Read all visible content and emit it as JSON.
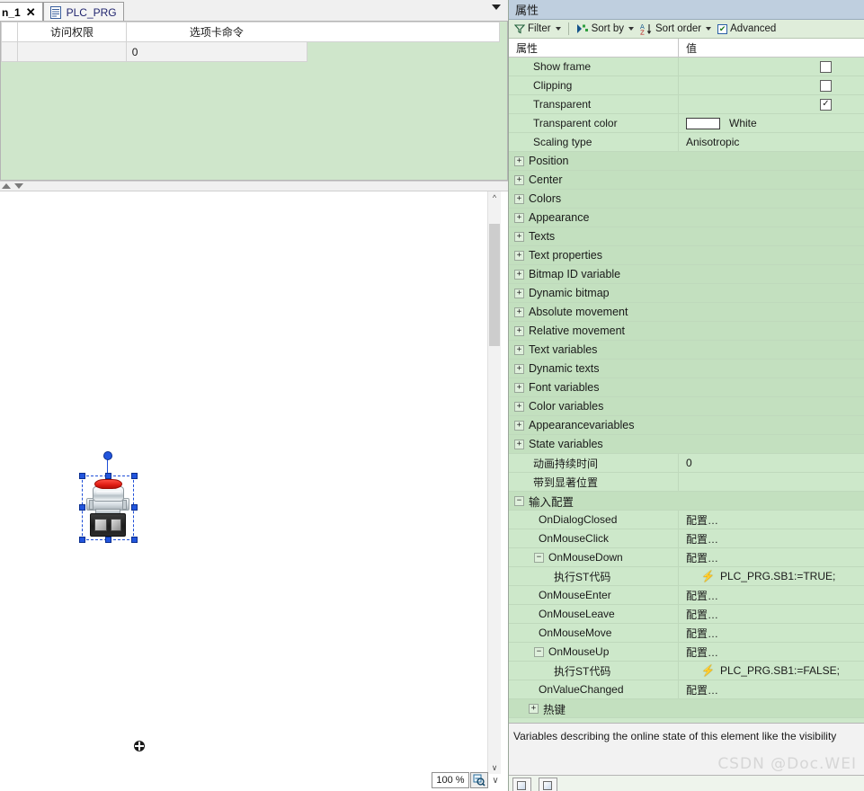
{
  "tabs": [
    {
      "label": "n_1",
      "closable": true,
      "active": true,
      "icon": ""
    },
    {
      "label": "PLC_PRG",
      "closable": false,
      "active": false,
      "icon": "document-icon"
    }
  ],
  "editor_grid": {
    "columns": [
      "",
      "访问权限",
      "选项卡命令",
      ""
    ],
    "rows": [
      [
        "",
        "",
        "0",
        ""
      ]
    ]
  },
  "canvas": {
    "element_name": "push-button-bitmap",
    "zoom_value": "100",
    "zoom_unit": "%"
  },
  "properties": {
    "title": "属性",
    "toolbar": {
      "filter_label": "Filter",
      "sort_by_label": "Sort by",
      "sort_order_label": "Sort order",
      "advanced_label": "Advanced",
      "advanced_checked": "✔"
    },
    "header": {
      "name": "属性",
      "value": "值"
    },
    "rows": [
      {
        "indent": 1,
        "name": "Show frame",
        "type": "checkbox",
        "checked": false
      },
      {
        "indent": 1,
        "name": "Clipping",
        "type": "checkbox",
        "checked": false
      },
      {
        "indent": 1,
        "name": "Transparent",
        "type": "checkbox",
        "checked": true
      },
      {
        "indent": 1,
        "name": "Transparent color",
        "type": "color",
        "value": "White",
        "swatch": "#ffffff"
      },
      {
        "indent": 1,
        "name": "Scaling type",
        "type": "text",
        "value": "Anisotropic"
      },
      {
        "indent": 0,
        "name": "Position",
        "type": "section",
        "expander": "+"
      },
      {
        "indent": 0,
        "name": "Center",
        "type": "section",
        "expander": "+"
      },
      {
        "indent": 0,
        "name": "Colors",
        "type": "section",
        "expander": "+"
      },
      {
        "indent": 0,
        "name": "Appearance",
        "type": "section",
        "expander": "+"
      },
      {
        "indent": 0,
        "name": "Texts",
        "type": "section",
        "expander": "+"
      },
      {
        "indent": 0,
        "name": "Text properties",
        "type": "section",
        "expander": "+"
      },
      {
        "indent": 0,
        "name": "Bitmap ID variable",
        "type": "section",
        "expander": "+"
      },
      {
        "indent": 0,
        "name": "Dynamic bitmap",
        "type": "section",
        "expander": "+"
      },
      {
        "indent": 0,
        "name": "Absolute movement",
        "type": "section",
        "expander": "+"
      },
      {
        "indent": 0,
        "name": "Relative movement",
        "type": "section",
        "expander": "+"
      },
      {
        "indent": 0,
        "name": "Text variables",
        "type": "section",
        "expander": "+"
      },
      {
        "indent": 0,
        "name": "Dynamic texts",
        "type": "section",
        "expander": "+"
      },
      {
        "indent": 0,
        "name": "Font variables",
        "type": "section",
        "expander": "+"
      },
      {
        "indent": 0,
        "name": "Color variables",
        "type": "section",
        "expander": "+"
      },
      {
        "indent": 0,
        "name": "Appearancevariables",
        "type": "section",
        "expander": "+"
      },
      {
        "indent": 0,
        "name": "State variables",
        "type": "section",
        "expander": "+"
      },
      {
        "indent": 1,
        "name": "动画持续时间",
        "type": "text",
        "value": "0"
      },
      {
        "indent": 1,
        "name": "带到显著位置",
        "type": "text",
        "value": ""
      },
      {
        "indent": 0,
        "name": "输入配置",
        "type": "section",
        "expander": "−"
      },
      {
        "indent": 2,
        "name": "OnDialogClosed",
        "type": "text",
        "value": "配置…"
      },
      {
        "indent": 2,
        "name": "OnMouseClick",
        "type": "text",
        "value": "配置…"
      },
      {
        "indent": 2,
        "name": "OnMouseDown",
        "type": "text",
        "value": "配置…",
        "expander": "−"
      },
      {
        "indent": 3,
        "name": "执行ST代码",
        "type": "code",
        "value": "PLC_PRG.SB1:=TRUE;"
      },
      {
        "indent": 2,
        "name": "OnMouseEnter",
        "type": "text",
        "value": "配置…"
      },
      {
        "indent": 2,
        "name": "OnMouseLeave",
        "type": "text",
        "value": "配置…"
      },
      {
        "indent": 2,
        "name": "OnMouseMove",
        "type": "text",
        "value": "配置…"
      },
      {
        "indent": 2,
        "name": "OnMouseUp",
        "type": "text",
        "value": "配置…",
        "expander": "−"
      },
      {
        "indent": 3,
        "name": "执行ST代码",
        "type": "code",
        "value": "PLC_PRG.SB1:=FALSE;"
      },
      {
        "indent": 2,
        "name": "OnValueChanged",
        "type": "text",
        "value": "配置…"
      },
      {
        "indent": 1,
        "name": "热键",
        "type": "section",
        "expander": "+"
      }
    ],
    "description": "Variables describing the online state of this element like the visibility"
  },
  "watermark": "CSDN @Doc.WEI"
}
